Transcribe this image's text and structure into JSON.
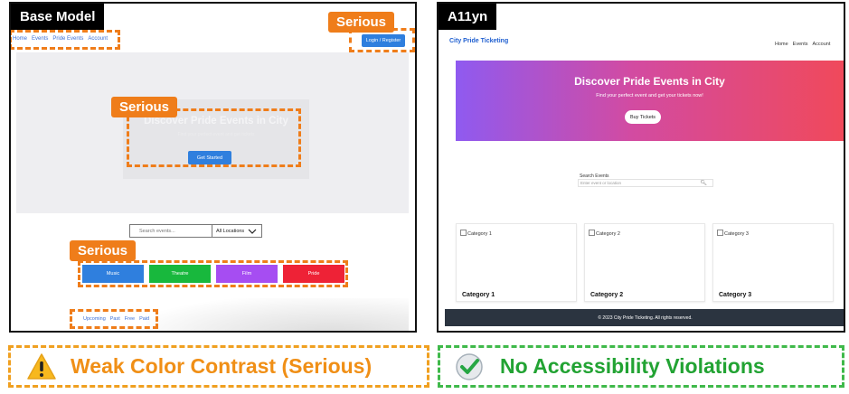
{
  "left_panel": {
    "label": "Base Model",
    "nav_links": [
      "Home",
      "Events",
      "Pride Events",
      "Account"
    ],
    "login_button": "Login / Register",
    "hero_title": "Discover Pride Events in City",
    "hero_subtitle": "Find your perfect event and get tickets",
    "hero_button": "Get Started",
    "search_placeholder": "Search events...",
    "location_select": "All Locations",
    "categories": [
      {
        "label": "Music",
        "color": "#2f7fde"
      },
      {
        "label": "Theatre",
        "color": "#18b83d"
      },
      {
        "label": "Film",
        "color": "#a64df2"
      },
      {
        "label": "Pride",
        "color": "#ee2236"
      }
    ],
    "filters": [
      "Upcoming",
      "Past",
      "Free",
      "Paid"
    ],
    "badges": [
      "Serious",
      "Serious",
      "Serious"
    ]
  },
  "right_panel": {
    "label": "A11yn",
    "brand": "City Pride Ticketing",
    "nav_links": [
      "Home",
      "Events",
      "Account"
    ],
    "hero_title": "Discover Pride Events in City",
    "hero_subtitle": "Find your perfect event and get your tickets now!",
    "hero_button": "Buy Tickets",
    "search_label": "Search Events",
    "search_placeholder": "Enter event or location",
    "cards": [
      {
        "image_alt": "Category 1",
        "title": "Category 1"
      },
      {
        "image_alt": "Category 2",
        "title": "Category 2"
      },
      {
        "image_alt": "Category 3",
        "title": "Category 3"
      }
    ],
    "footer": "© 2023 City Pride Ticketing. All rights reserved."
  },
  "verdicts": {
    "left": "Weak Color Contrast (Serious)",
    "right": "No Accessibility Violations"
  },
  "colors": {
    "serious_badge": "#ef7d1a",
    "warning_text": "#f08f16",
    "success_text": "#22a333"
  },
  "icons": {
    "left_verdict": "warning-triangle-icon",
    "right_verdict": "check-circle-icon"
  }
}
